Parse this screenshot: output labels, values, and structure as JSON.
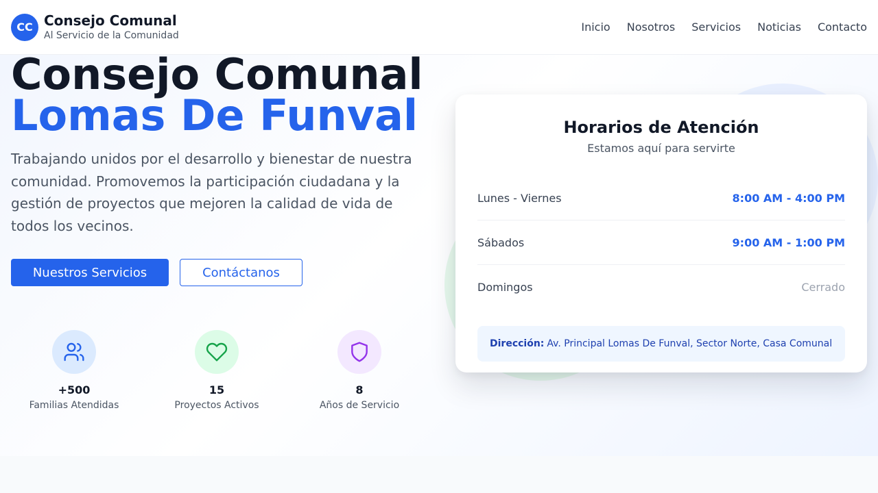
{
  "header": {
    "logo_text": "CC",
    "title": "Consejo Comunal",
    "subtitle": "Al Servicio de la Comunidad",
    "nav": [
      "Inicio",
      "Nosotros",
      "Servicios",
      "Noticias",
      "Contacto"
    ]
  },
  "hero": {
    "title_line1": "Consejo Comunal",
    "title_line2": "Lomas De Funval",
    "description": "Trabajando unidos por el desarrollo y bienestar de nuestra comunidad. Promovemos la participación ciudadana y la gestión de proyectos que mejoren la calidad de vida de todos los vecinos.",
    "primary_button": "Nuestros Servicios",
    "secondary_button": "Contáctanos",
    "stats": [
      {
        "value": "+500",
        "label": "Familias Atendidas",
        "icon": "users-icon",
        "color": "#2563eb",
        "bg": "#dbeafe"
      },
      {
        "value": "15",
        "label": "Proyectos Activos",
        "icon": "heart-icon",
        "color": "#16a34a",
        "bg": "#dcfce7"
      },
      {
        "value": "8",
        "label": "Años de Servicio",
        "icon": "shield-icon",
        "color": "#9333ea",
        "bg": "#f3e8ff"
      }
    ]
  },
  "schedule": {
    "title": "Horarios de Atención",
    "subtitle": "Estamos aquí para servirte",
    "rows": [
      {
        "day": "Lunes - Viernes",
        "hours": "8:00 AM - 4:00 PM"
      },
      {
        "day": "Sábados",
        "hours": "9:00 AM - 1:00 PM"
      },
      {
        "day": "Domingos",
        "hours": "Cerrado"
      }
    ],
    "address_label": "Dirección:",
    "address_value": "Av. Principal Lomas De Funval, Sector Norte, Casa Comunal"
  },
  "colors": {
    "primary": "#2563eb",
    "text_dark": "#111827",
    "closed": "#9ca3af"
  }
}
